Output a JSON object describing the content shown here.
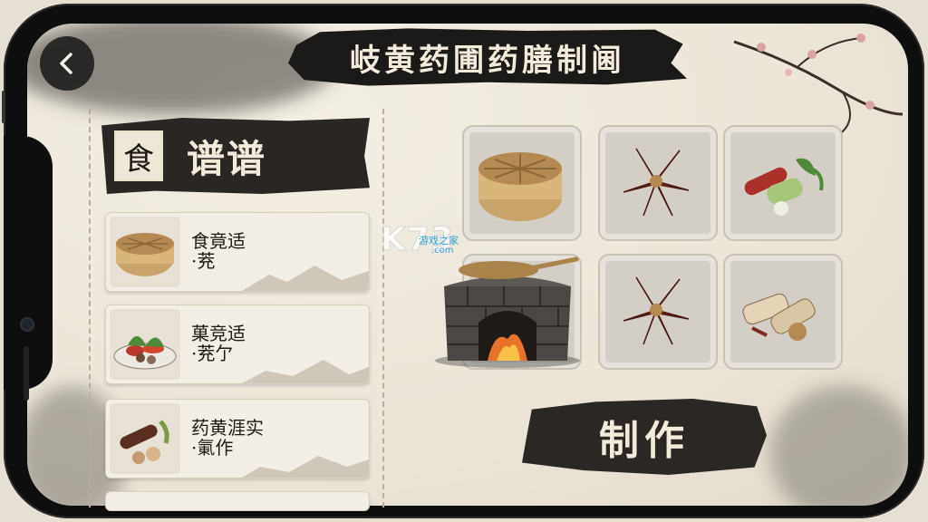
{
  "header": {
    "title": "岐黄药圃药膳制阃"
  },
  "left_panel": {
    "seal_char": "食",
    "title": "谱谱",
    "recipes": [
      {
        "name": "食竟适\n·茺"
      },
      {
        "name": "菓竞适\n·茺亇"
      },
      {
        "name": "药黄涯实\n·氭作"
      }
    ]
  },
  "ingredients": [
    {
      "icon": "steamer-basket-icon"
    },
    {
      "icon": "dried-herb-flower-icon"
    },
    {
      "icon": "vegetables-icon"
    },
    {
      "icon": "stove-with-wok-icon"
    },
    {
      "icon": "dried-herb-flower-icon"
    },
    {
      "icon": "root-slices-icon"
    }
  ],
  "craft_button": {
    "label": "制作"
  },
  "watermark": {
    "logo": "K73",
    "text": "游戏之家",
    "url": ".com"
  }
}
